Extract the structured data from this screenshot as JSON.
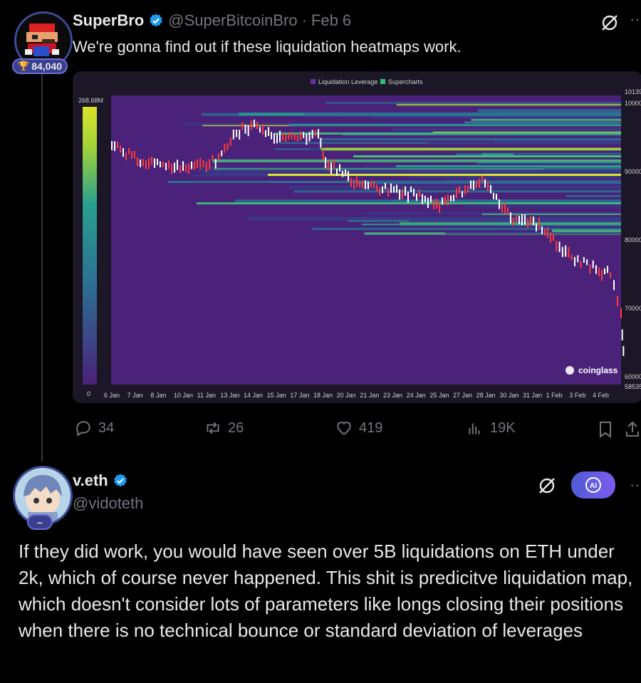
{
  "tweet": {
    "author": "SuperBro",
    "handle": "@SuperBitcoinBro",
    "separator": "·",
    "date": "Feb 6",
    "badge_count": "84,040",
    "text": "We're gonna find out if these liquidation heatmaps work.",
    "stats": {
      "replies": "34",
      "reposts": "26",
      "likes": "419",
      "views": "19K"
    }
  },
  "chart": {
    "legend": [
      "Liquidation Leverage",
      "Supercharts"
    ],
    "scale_top": "268.68M",
    "scale_bottom": "0",
    "watermark": "coinglass",
    "y_ticks": [
      "10139",
      "10000",
      "90000",
      "80000",
      "70000",
      "60000",
      "58535"
    ],
    "x_ticks": [
      "6 Jan",
      "7 Jan",
      "8 Jan",
      "10 Jan",
      "11 Jan",
      "13 Jan",
      "14 Jan",
      "15 Jan",
      "17 Jan",
      "18 Jan",
      "20 Jan",
      "21 Jan",
      "23 Jan",
      "24 Jan",
      "25 Jan",
      "27 Jan",
      "28 Jan",
      "30 Jan",
      "31 Jan",
      "1 Feb",
      "3 Feb",
      "4 Feb"
    ],
    "colors": {
      "low": "#4a2279",
      "mid": "#27a08e",
      "high": "#dbe32a",
      "candle_up": "#ffffff",
      "candle_down": "#ff3b3b"
    }
  },
  "reply": {
    "author": "v.eth",
    "handle": "@vidoteth",
    "badge": "–",
    "ai_label": "AI",
    "text": "If they did work, you would have seen over 5B liquidations on ETH under 2k, which of course never happened. This shit is predicitve liquidation map, which doesn't consider lots of parameters like longs closing their positions when there is no technical bounce or standard deviation of leverages"
  },
  "icons": [
    "verified-icon",
    "grok-icon",
    "more-icon",
    "reply-icon",
    "repost-icon",
    "like-icon",
    "views-icon",
    "bookmark-icon",
    "share-icon",
    "ai-icon",
    "trophy-icon"
  ]
}
